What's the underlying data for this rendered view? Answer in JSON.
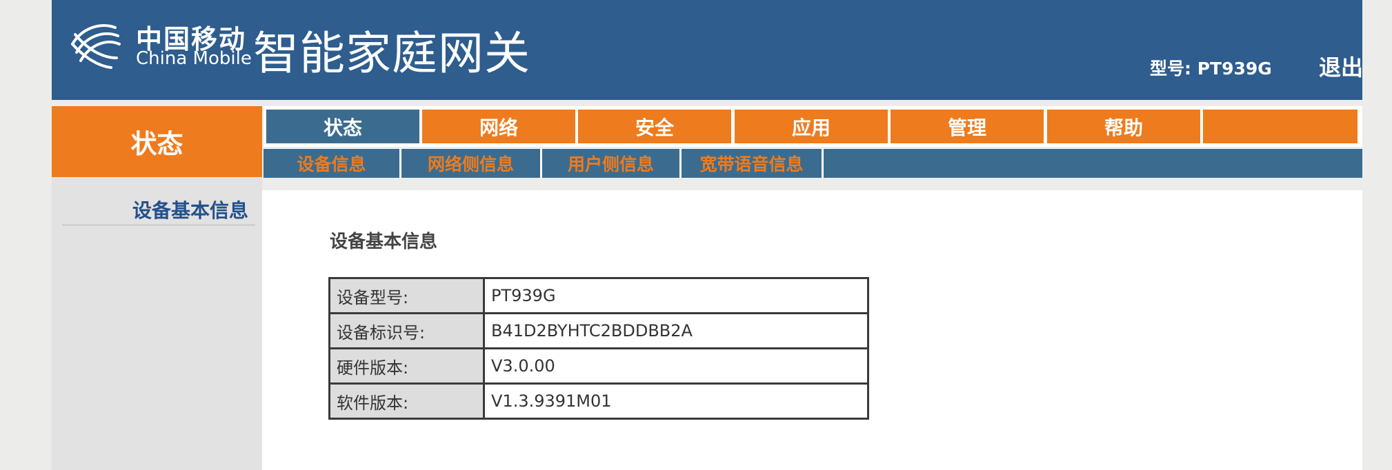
{
  "header": {
    "brand_cn": "中国移动",
    "brand_en": "China Mobile",
    "product": "智能家庭网关",
    "model_label": "型号: PT939G",
    "logout_label": "退出"
  },
  "section_title": "状态",
  "nav": {
    "tabs": [
      "状态",
      "网络",
      "安全",
      "应用",
      "管理",
      "帮助"
    ],
    "active_tab": "状态"
  },
  "subnav": {
    "tabs": [
      "设备信息",
      "网络侧信息",
      "用户侧信息",
      "宽带语音信息"
    ],
    "active_tab": "设备信息"
  },
  "sidebar": {
    "items": [
      "设备基本信息"
    ]
  },
  "content": {
    "title": "设备基本信息",
    "rows": [
      {
        "label": "设备型号:",
        "value": "PT939G"
      },
      {
        "label": "设备标识号:",
        "value": "B41D2BYHTC2BDDBB2A"
      },
      {
        "label": "硬件版本:",
        "value": "V3.0.00"
      },
      {
        "label": "软件版本:",
        "value": "V1.3.9391M01"
      }
    ]
  },
  "colors": {
    "header_blue": "#2e5d8e",
    "accent_orange": "#ee7b1d",
    "active_tab_blue": "#3b6c8f",
    "sidebar_link": "#24508a"
  }
}
